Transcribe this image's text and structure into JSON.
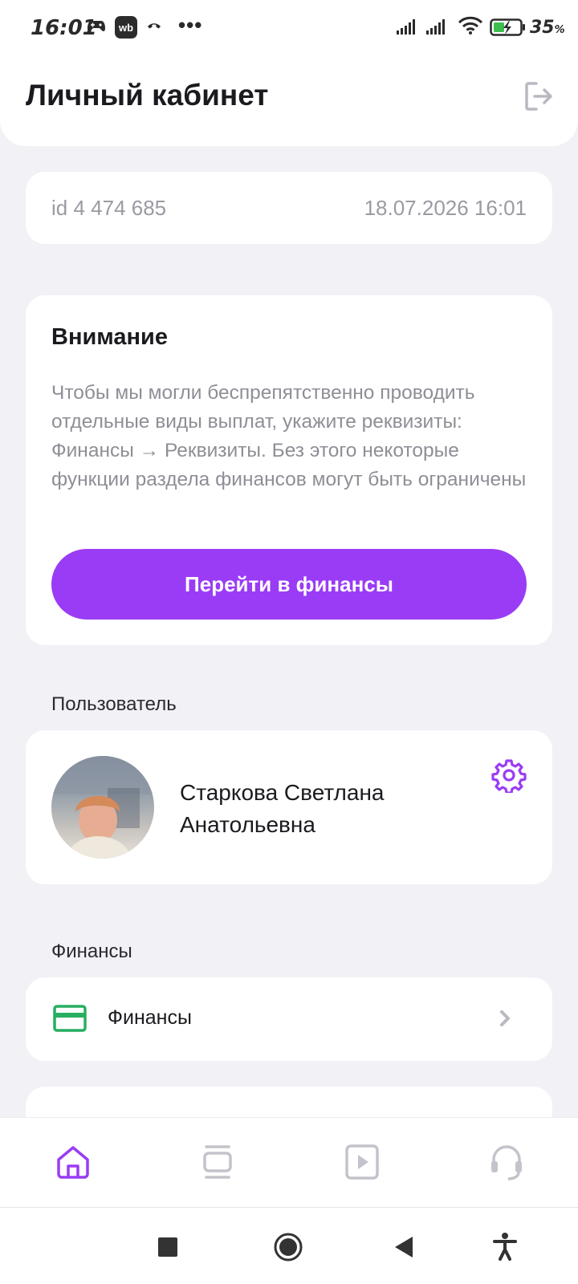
{
  "status_bar": {
    "time": "16:01",
    "wb_label": "wb",
    "more": "•••",
    "battery_percent": "35",
    "battery_unit": "%"
  },
  "header": {
    "title": "Личный кабинет"
  },
  "account": {
    "id": "id 4 474 685",
    "datetime": "18.07.2026 16:01"
  },
  "notice": {
    "title": "Внимание",
    "text": "Чтобы мы могли беспрепятственно проводить отдельные виды выплат, укажите реквизиты: Финансы → Реквизиты. Без этого некоторые функции раздела финансов могут быть ограничены",
    "button_label": "Перейти в финансы"
  },
  "user_section": {
    "label": "Пользователь",
    "name_line1": "Старкова Светлана",
    "name_line2": "Анатольевна"
  },
  "finance_section": {
    "label": "Финансы",
    "item_label": "Финансы"
  },
  "colors": {
    "accent": "#9a3cf5",
    "background": "#f1f1f6",
    "finance_icon": "#27ae60",
    "muted_text": "#9a9aa3"
  },
  "icons": {
    "logout": "logout-icon",
    "settings": "gear-icon",
    "finance": "credit-card-icon",
    "chevron": "chevron-right-icon",
    "nav_home": "home-icon",
    "nav_feed": "feed-icon",
    "nav_video": "play-icon",
    "nav_support": "headset-icon"
  },
  "bottom_nav": {
    "active": "home"
  }
}
